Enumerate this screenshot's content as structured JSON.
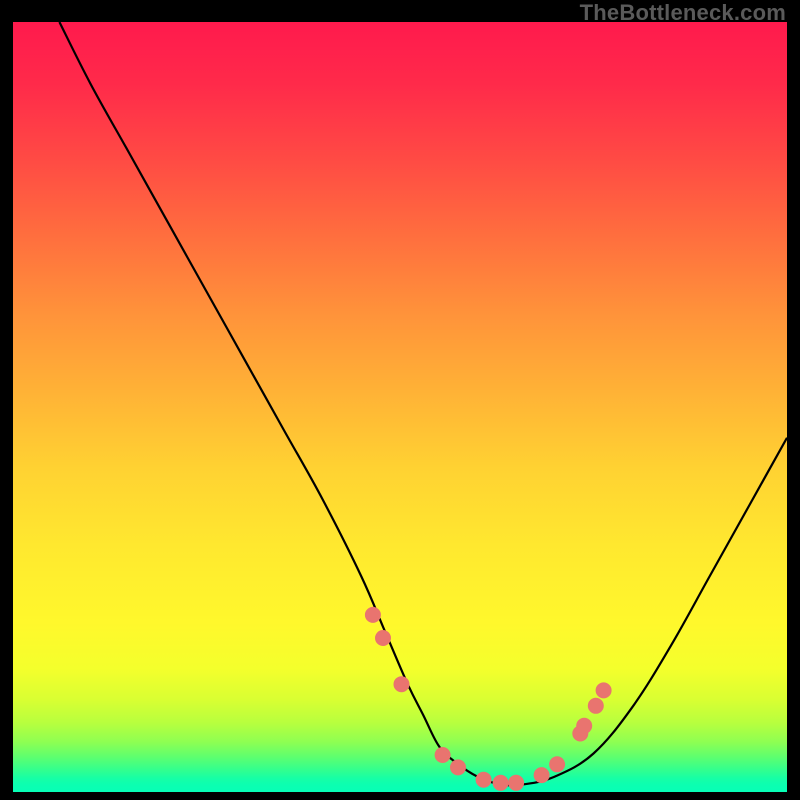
{
  "watermark": "TheBottleneck.com",
  "colors": {
    "dot": "#e9746f",
    "curve": "#000000"
  },
  "chart_data": {
    "type": "line",
    "title": "",
    "xlabel": "",
    "ylabel": "",
    "xlim": [
      0,
      100
    ],
    "ylim": [
      0,
      100
    ],
    "x": [
      6,
      10,
      15,
      20,
      25,
      30,
      35,
      40,
      45,
      48,
      51,
      53,
      55,
      57,
      60,
      63,
      66,
      70,
      75,
      80,
      85,
      90,
      95,
      100
    ],
    "values": [
      100,
      92,
      83,
      74,
      65,
      56,
      47,
      38,
      28,
      21,
      14,
      10,
      6,
      4,
      2,
      1,
      1,
      2,
      5,
      11,
      19,
      28,
      37,
      46
    ],
    "series": [
      {
        "name": "dots",
        "x": [
          46.5,
          47.8,
          50.2,
          55.5,
          57.5,
          60.8,
          63,
          65,
          68.3,
          70.3,
          73.3,
          73.8,
          75.3,
          76.3
        ],
        "values": [
          23,
          20,
          14,
          4.8,
          3.2,
          1.6,
          1.2,
          1.2,
          2.2,
          3.6,
          7.6,
          8.6,
          11.2,
          13.2
        ]
      }
    ]
  }
}
